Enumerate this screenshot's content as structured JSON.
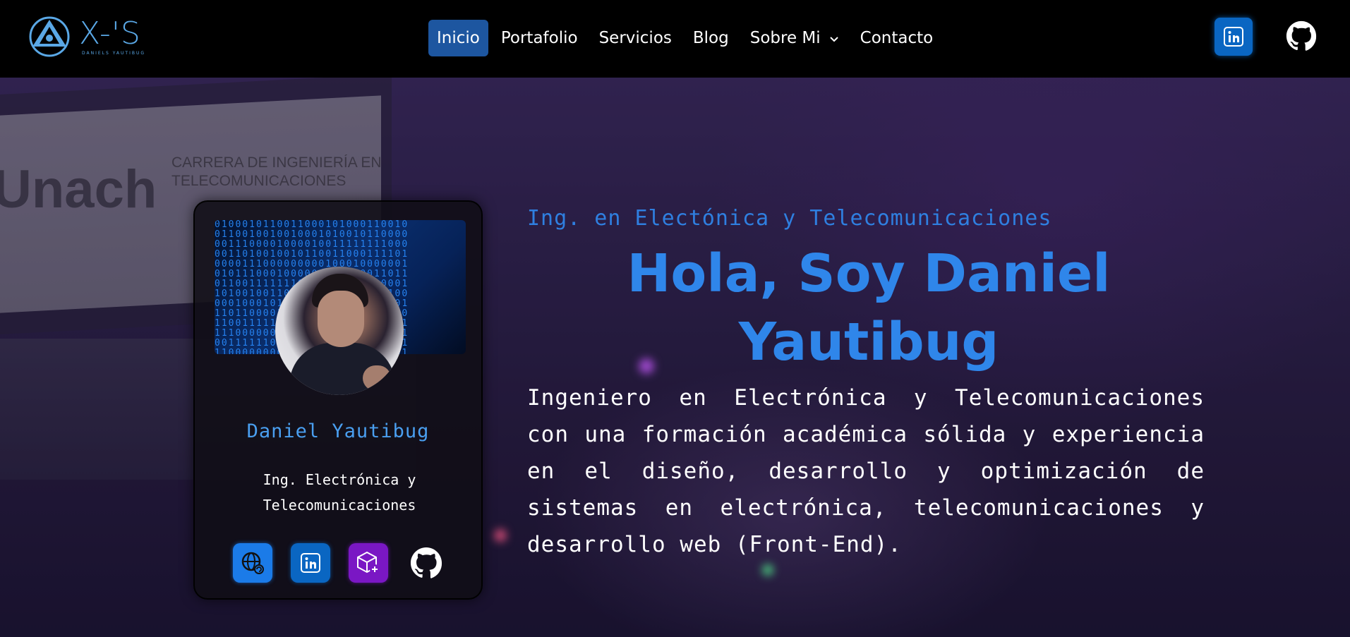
{
  "brand": {
    "logo_text": "X-'S",
    "logo_subtext": "DANIELS YAUTIBUG"
  },
  "nav": {
    "items": [
      {
        "label": "Inicio",
        "active": true
      },
      {
        "label": "Portafolio",
        "active": false
      },
      {
        "label": "Servicios",
        "active": false
      },
      {
        "label": "Blog",
        "active": false
      },
      {
        "label": "Sobre Mi",
        "active": false,
        "dropdown": true
      },
      {
        "label": "Contacto",
        "active": false
      }
    ],
    "social": [
      {
        "icon": "linkedin-icon",
        "color": "#0a66c2"
      },
      {
        "icon": "github-icon",
        "color": "#ffffff"
      }
    ]
  },
  "background": {
    "laptop_logo": "Unach",
    "laptop_caption": "CARRERA DE INGENIERÍA EN TELECOMUNICACIONES"
  },
  "card": {
    "name": "Daniel Yautibug",
    "title": "Ing. Electrónica y Telecomunicaciones",
    "icons": [
      {
        "icon": "web-icon",
        "color": "#1b7be8"
      },
      {
        "icon": "linkedin-icon",
        "color": "#0a66c2"
      },
      {
        "icon": "box-add-icon",
        "color": "#7a17c4"
      },
      {
        "icon": "github-icon",
        "color": "#ffffff"
      }
    ]
  },
  "hero": {
    "subtitle": "Ing. en Electónica y Telecomunicaciones",
    "headline": "Hola, Soy Daniel Yautibug",
    "description": "Ingeniero en Electrónica y Telecomunicaciones con una formación académica sólida y experiencia en el diseño, desarrollo y optimización de sistemas en electrónica, telecomunicaciones y desarrollo web (Front-End)."
  },
  "colors": {
    "accent": "#2f86ea",
    "nav_active": "#1d56a0",
    "background": "#000000"
  }
}
